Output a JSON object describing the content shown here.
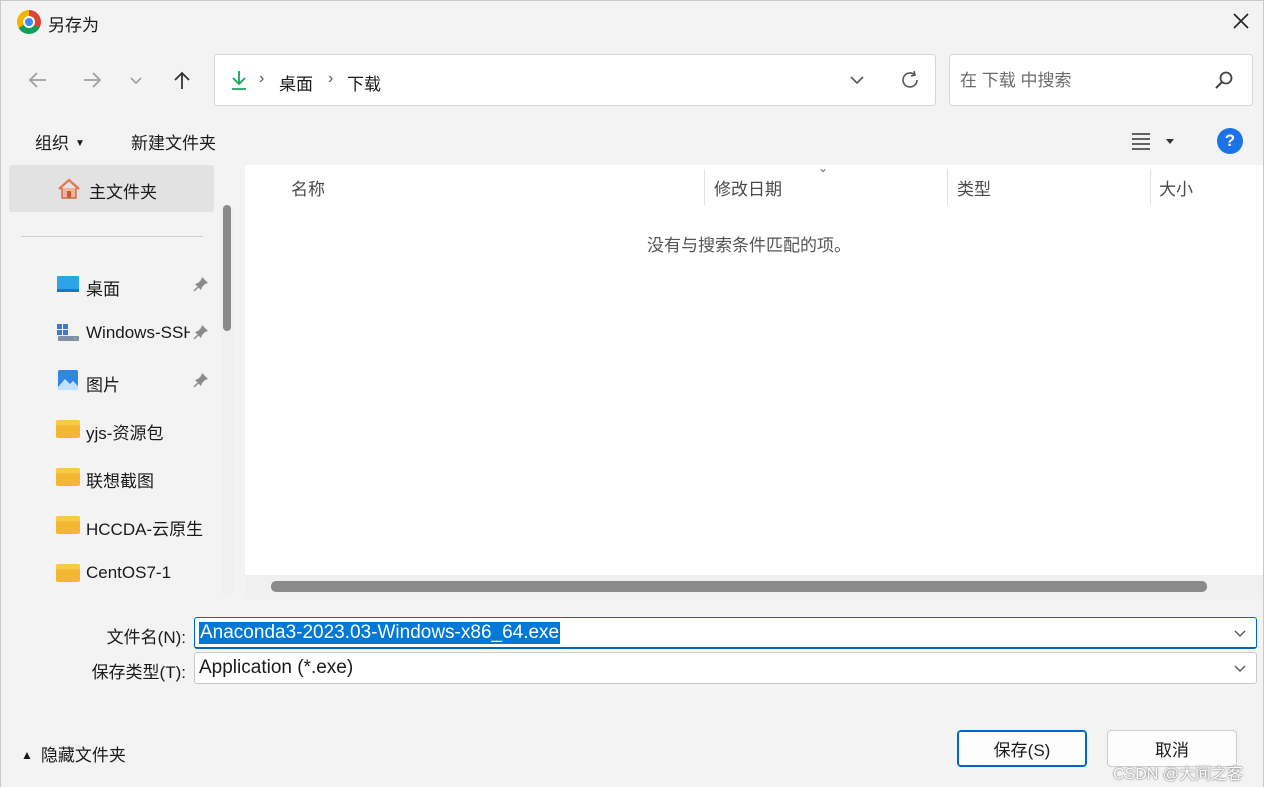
{
  "window": {
    "title": "另存为"
  },
  "nav": {
    "breadcrumbs": [
      "桌面",
      "下载"
    ],
    "search_placeholder": "在 下载 中搜索"
  },
  "toolbar": {
    "organize": "组织",
    "new_folder": "新建文件夹"
  },
  "sidebar": {
    "home": "主文件夹",
    "items": [
      {
        "label": "桌面",
        "icon": "desktop-icon",
        "pinned": true
      },
      {
        "label": "Windows-SSH",
        "icon": "network-drive-icon",
        "pinned": true
      },
      {
        "label": "图片",
        "icon": "pictures-icon",
        "pinned": true
      },
      {
        "label": "yjs-资源包",
        "icon": "folder-icon",
        "pinned": false
      },
      {
        "label": "联想截图",
        "icon": "folder-icon",
        "pinned": false
      },
      {
        "label": "HCCDA-云原生",
        "icon": "folder-icon",
        "pinned": false
      },
      {
        "label": "CentOS7-1",
        "icon": "folder-icon",
        "pinned": false
      }
    ]
  },
  "file_list": {
    "columns": [
      "名称",
      "修改日期",
      "类型",
      "大小"
    ],
    "empty_message": "没有与搜索条件匹配的项。"
  },
  "save": {
    "filename_label": "文件名(N):",
    "filename_value": "Anaconda3-2023.03-Windows-x86_64.exe",
    "filetype_label": "保存类型(T):",
    "filetype_value": "Application (*.exe)"
  },
  "footer": {
    "hide_folders": "隐藏文件夹",
    "save_button": "保存(S)",
    "cancel_button": "取消",
    "watermark": "CSDN @大间之客"
  },
  "colors": {
    "accent": "#0067c0",
    "selection": "#0078d7",
    "help": "#1a73e8"
  }
}
